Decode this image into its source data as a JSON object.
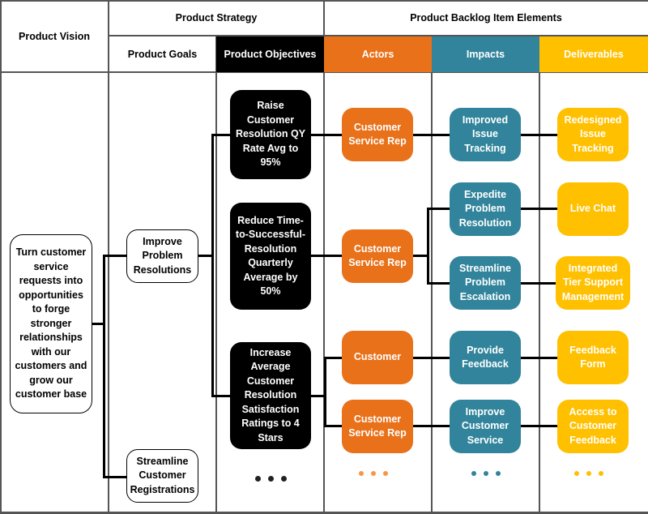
{
  "header": {
    "product_vision": "Product Vision",
    "product_strategy": "Product Strategy",
    "product_backlog": "Product Backlog Item Elements",
    "product_goals": "Product Goals",
    "product_objectives": "Product Objectives",
    "actors": "Actors",
    "impacts": "Impacts",
    "deliverables": "Deliverables"
  },
  "colors": {
    "objectives": "#000000",
    "actors": "#E8711A",
    "impacts": "#31849B",
    "deliverables": "#FFC000",
    "actors_dots": "#F79646"
  },
  "vision": "Turn customer\nservice\nrequests into\nopportunities\nto forge\nstronger\nrelationships\nwith our\ncustomers and\ngrow our\ncustomer base",
  "goals": [
    "Improve\nProblem\nResolutions",
    "Streamline\nCustomer\nRegistrations"
  ],
  "objectives": [
    "Raise\nCustomer\nResolution QY\nRate Avg to\n95%",
    "Reduce Time-\nto-Successful-\nResolution\nQuarterly\nAverage by\n50%",
    "Increase\nAverage\nCustomer\nResolution\nSatisfaction\nRatings to 4\nStars"
  ],
  "actors": [
    "Customer\nService Rep",
    "Customer\nService Rep",
    "Customer",
    "Customer\nService Rep"
  ],
  "impacts": [
    "Improved\nIssue\nTracking",
    "Expedite\nProblem\nResolution",
    "Streamline\nProblem\nEscalation",
    "Provide\nFeedback",
    "Improve\nCustomer\nService"
  ],
  "deliverables": [
    "Redesigned\nIssue\nTracking",
    "Live Chat",
    "Integrated\nTier Support\nManagement",
    "Feedback\nForm",
    "Access to\nCustomer\nFeedback"
  ],
  "ellipsis": "more-items"
}
